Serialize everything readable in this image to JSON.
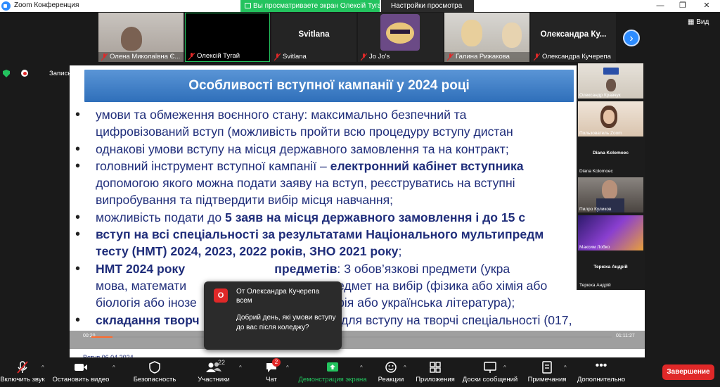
{
  "window": {
    "app_title": "Zoom Конференция",
    "share_banner": "Вы просматриваете экран Олексій Тугай",
    "view_settings": "Настройки просмотра",
    "controls": [
      "—",
      "❐",
      "✕"
    ],
    "view_label": "Вид"
  },
  "thumbnails": [
    {
      "name": "Олена Миколаївна Є..."
    },
    {
      "name": "Олексій Тугай"
    },
    {
      "name": "Svitlana",
      "big_name": "Svitlana"
    },
    {
      "name": "Jo Jo's"
    },
    {
      "name": "Галина Рижакова"
    },
    {
      "name": "Олександра Кучерепа",
      "big_name": "Олександра Ку..."
    }
  ],
  "recording": {
    "label": "Запись..."
  },
  "slide": {
    "title": "Особливості вступної кампанії у 2024 році",
    "lines": [
      {
        "bullet": true,
        "parts": [
          {
            "t": "умови та обмеження воєнного стану: максимально безпечний та"
          }
        ]
      },
      {
        "bullet": false,
        "parts": [
          {
            "t": "цифровізований вступ (можливість пройти всю процедуру вступу дистан"
          }
        ]
      },
      {
        "bullet": true,
        "parts": [
          {
            "t": "однакові умови вступу на місця державного замовлення та на контракт;"
          }
        ]
      },
      {
        "bullet": true,
        "parts": [
          {
            "t": "головний інструмент вступної кампанії – "
          },
          {
            "t": "електронний кабінет вступника",
            "b": true
          }
        ]
      },
      {
        "bullet": false,
        "parts": [
          {
            "t": "допомогою якого можна подати заяву на вступ, реєструватись на вступні"
          }
        ]
      },
      {
        "bullet": false,
        "parts": [
          {
            "t": "випробування та підтвердити вибір місця навчання;"
          }
        ]
      },
      {
        "bullet": true,
        "parts": [
          {
            "t": "можливість подати до "
          },
          {
            "t": "5 заяв на місця державного замовлення і до 15 с",
            "b": true
          }
        ]
      },
      {
        "bullet": true,
        "parts": [
          {
            "t": "вступ на всі спеціальності за результатами Національного мультипредм",
            "b": true
          }
        ]
      },
      {
        "bullet": false,
        "parts": [
          {
            "t": "тесту (НМТ) 2024, 2023, 2022 років, ЗНО 2021 року",
            "b": true
          },
          {
            "t": ";"
          }
        ]
      },
      {
        "bullet": true,
        "parts": [
          {
            "t": "НМТ 2024 року ",
            "b": true
          },
          {
            "t": "                         ",
            "b": false
          },
          {
            "t": "предметів",
            "b": true
          },
          {
            "t": ": 3 обов’язкові предмети (укра"
          }
        ]
      },
      {
        "bullet": false,
        "parts": [
          {
            "t": "мова, математи"
          },
          {
            "t": "                                        "
          },
          {
            "t": "предмет на вибір (фізика або хімія або"
          }
        ]
      },
      {
        "bullet": false,
        "parts": [
          {
            "t": "біологія або інозе"
          },
          {
            "t": "                                    "
          },
          {
            "t": "рафія або українська література);"
          }
        ]
      },
      {
        "bullet": true,
        "parts": [
          {
            "t": "складання творч",
            "b": true
          },
          {
            "t": "                                      "
          },
          {
            "t": "Т для вступу на творчі спеціальності (017,"
          }
        ]
      }
    ],
    "footer": "Вступ 06.04.2024"
  },
  "sidebar_participants": [
    {
      "name": "Олександр Кравчук"
    },
    {
      "name": "Пользователь Zoom"
    },
    {
      "name": "Diana Kolomoec",
      "big_name": "Diana Kolomoec"
    },
    {
      "name": "Пилро Куликов"
    },
    {
      "name": "Максим Лобко"
    },
    {
      "name": "Терюха Андрій",
      "big_name": "Терюха Андрій"
    }
  ],
  "player": {
    "current": "00:20",
    "total": "01:11:27",
    "progress_fraction": 0.04
  },
  "chat": {
    "avatar_letter": "О",
    "from": "От Олександра Кучерепа",
    "to": "всем",
    "message": "Добрий  день, які умови вступу до вас після коледжу?"
  },
  "toolbar": {
    "audio": "Включить звук",
    "video": "Остановить видео",
    "security": "Безопасность",
    "participants": "Участники",
    "participants_count": "22",
    "chat": "Чат",
    "chat_badge": "2",
    "share": "Демонстрация экрана",
    "reactions": "Реакции",
    "apps": "Приложения",
    "whiteboard": "Доски сообщений",
    "notes": "Примечания",
    "more": "Дополнительно",
    "end": "Завершение"
  },
  "colors": {
    "accent": "#2d8cff",
    "share_green": "#23c35e",
    "danger": "#e02828",
    "slide_text": "#1f2d7a"
  }
}
